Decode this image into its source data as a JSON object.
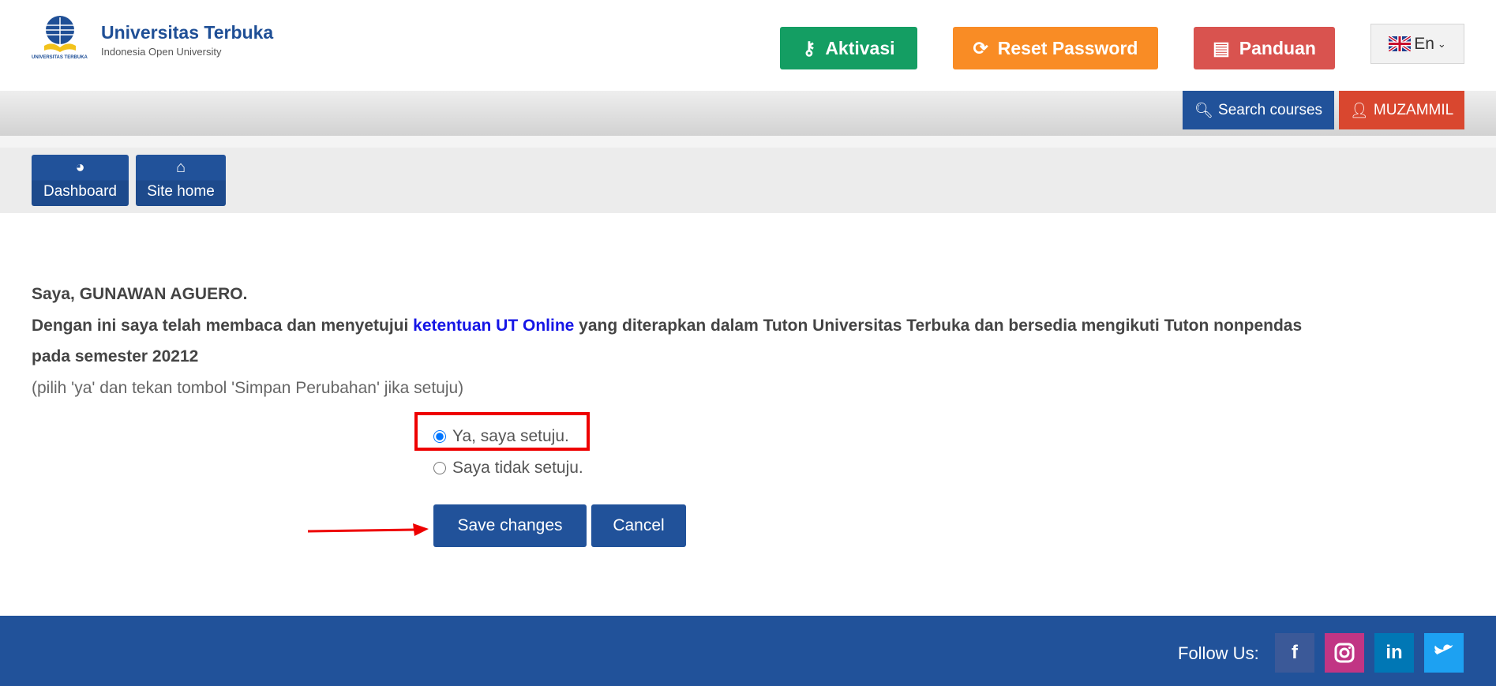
{
  "header": {
    "logo_title": "Universitas Terbuka",
    "logo_subtitle": "Indonesia Open University",
    "logo_small": "UNIVERSITAS TERBUKA",
    "buttons": [
      {
        "label": "Aktivasi",
        "icon": "key-icon",
        "color": "#149e63"
      },
      {
        "label": "Reset Password",
        "icon": "refresh-icon",
        "color": "#f98c25"
      },
      {
        "label": "Panduan",
        "icon": "document-icon",
        "color": "#d9534f"
      }
    ],
    "language": "En"
  },
  "topbar": {
    "search": "Search courses",
    "user": "MUZAMMIL"
  },
  "nav": [
    {
      "label": "Dashboard",
      "icon": "dashboard-icon"
    },
    {
      "label": "Site home",
      "icon": "home-icon"
    }
  ],
  "main": {
    "line1": "Saya, GUNAWAN AGUERO.",
    "line2_pre": "Dengan ini saya telah membaca dan menyetujui ",
    "line2_link": "ketentuan UT Online",
    "line2_post": " yang diterapkan dalam Tuton Universitas Terbuka dan bersedia mengikuti Tuton nonpendas",
    "line3": "pada semester 20212",
    "hint": "(pilih 'ya' dan tekan tombol 'Simpan Perubahan' jika setuju)",
    "options": [
      {
        "label": "Ya, saya setuju.",
        "checked": true
      },
      {
        "label": "Saya tidak setuju.",
        "checked": false
      }
    ],
    "save": "Save changes",
    "cancel": "Cancel"
  },
  "footer": {
    "follow": "Follow Us:",
    "social": [
      {
        "name": "facebook",
        "color": "#3b5998"
      },
      {
        "name": "instagram",
        "color": "#c13584"
      },
      {
        "name": "linkedin",
        "color": "#0077b5"
      },
      {
        "name": "twitter",
        "color": "#1da1f2"
      }
    ]
  },
  "colors": {
    "primary": "#21529a",
    "user": "#d9472f",
    "annotation": "#e00000"
  }
}
